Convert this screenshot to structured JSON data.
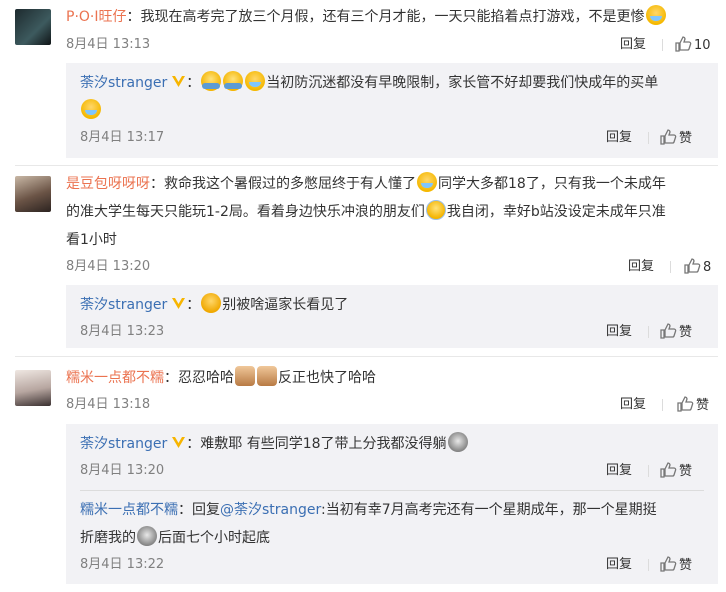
{
  "comments": [
    {
      "user": "P·O·I旺仔",
      "text": "：我现在高考完了放三个月假，还有三个月才能，一天只能掐着点打游戏，不是更惨",
      "time": "8月4日 13:13",
      "reply_label": "回复",
      "likes": "10"
    },
    {
      "user": "是豆包呀呀呀",
      "text1": "：救命我这个暑假过的多憋屈终于有人懂了",
      "text2": "同学大多都18了，只有我一个未成年",
      "text3": "的准大学生每天只能玩1-2局。看着身边快乐冲浪的朋友们",
      "text4": "我自闭，幸好b站没设定未成年只准",
      "text5": "看1小时",
      "time": "8月4日 13:20",
      "reply_label": "回复",
      "likes": "8"
    },
    {
      "user": "糯米一点都不糯",
      "text1": "：忍忍哈哈",
      "text2": "反正也快了哈哈",
      "time": "8月4日 13:18",
      "reply_label": "回复",
      "like_label": "赞"
    }
  ],
  "replies": [
    {
      "user": "荼汐stranger",
      "text1": "：",
      "text2": "当初防沉迷都没有早晚限制，家长管不好却要我们快成年的买单",
      "time": "8月4日 13:17",
      "reply_label": "回复",
      "like_label": "赞"
    },
    {
      "user": "荼汐stranger",
      "text1": "：",
      "text2": "别被啥逼家长看见了",
      "time": "8月4日 13:23",
      "reply_label": "回复",
      "like_label": "赞"
    },
    {
      "user": "荼汐stranger",
      "text1": "：难敷耶 有些同学18了带上分我都没得躺",
      "time": "8月4日 13:20",
      "reply_label": "回复",
      "like_label": "赞"
    },
    {
      "user": "糯米一点都不糯",
      "text1": "：回复",
      "mention": "@荼汐stranger",
      "text2": ":当初有幸7月高考完还有一个星期成年，那一个星期挺",
      "text3": "折磨我的",
      "text4": "后面七个小时起底",
      "time": "8月4日 13:22",
      "reply_label": "回复",
      "like_label": "赞"
    }
  ],
  "colors": {
    "username": "#eb7350",
    "reply_username": "#3b6fb3",
    "reply_background": "#f2f2f5",
    "meta_text": "#808080"
  }
}
